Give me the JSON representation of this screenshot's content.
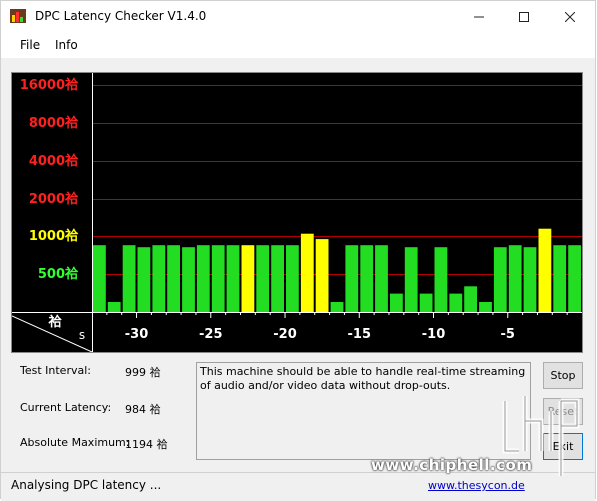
{
  "window": {
    "title": "DPC Latency Checker V1.4.0",
    "controls": {
      "minimize": "—",
      "maximize": "☐",
      "close": "✕"
    }
  },
  "menu": {
    "items": [
      "File",
      "Info"
    ]
  },
  "graph": {
    "background": "#000000",
    "grid_color": "#c00000",
    "y_labels": [
      {
        "text": "16000祫",
        "color": "#ff2020"
      },
      {
        "text": "8000祫",
        "color": "#ff2020"
      },
      {
        "text": "4000祫",
        "color": "#ff2020"
      },
      {
        "text": "2000祫",
        "color": "#ff2020"
      },
      {
        "text": "1000祫",
        "color": "#ffff00"
      },
      {
        "text": "500祫",
        "color": "#33ff33"
      }
    ],
    "unit_label": "祫",
    "x_unit": "s",
    "x_ticks": [
      "-30",
      "-25",
      "-20",
      "-15",
      "-10",
      "-5"
    ]
  },
  "chart_data": {
    "type": "bar",
    "scale": "log2",
    "y_unit": "祫",
    "ylim": [
      250,
      16000
    ],
    "x_unit": "s",
    "xlim": [
      -33,
      0
    ],
    "x_ticks": [
      -30,
      -25,
      -20,
      -15,
      -10,
      -5
    ],
    "bar_colors": {
      "green": "#22dd22",
      "yellow": "#ffff00"
    },
    "values": [
      850,
      300,
      850,
      820,
      850,
      850,
      820,
      850,
      850,
      850,
      850,
      850,
      850,
      850,
      1050,
      950,
      300,
      850,
      850,
      850,
      350,
      820,
      350,
      820,
      350,
      400,
      300,
      820,
      850,
      820,
      1150,
      850,
      850
    ],
    "colors": [
      "green",
      "green",
      "green",
      "green",
      "green",
      "green",
      "green",
      "green",
      "green",
      "green",
      "yellow",
      "green",
      "green",
      "green",
      "yellow",
      "yellow",
      "green",
      "green",
      "green",
      "green",
      "green",
      "green",
      "green",
      "green",
      "green",
      "green",
      "green",
      "green",
      "green",
      "green",
      "yellow",
      "green",
      "green"
    ]
  },
  "stats": {
    "test_interval_label": "Test Interval:",
    "test_interval_value": "999 祫",
    "current_latency_label": "Current Latency:",
    "current_latency_value": "984 祫",
    "absolute_maximum_label": "Absolute Maximum:",
    "absolute_maximum_value": "1194 祫"
  },
  "message": "This machine should be able to handle real-time streaming of audio and/or video data without drop-outs.",
  "buttons": {
    "stop": "Stop",
    "reset": "Reset",
    "exit": "Exit"
  },
  "status": {
    "text": "Analysing DPC latency ...",
    "link": "www.thesycon.de"
  },
  "watermark": "www.chiphell.com"
}
